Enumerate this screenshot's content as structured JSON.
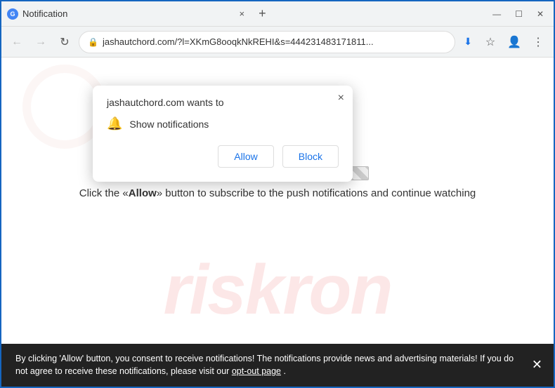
{
  "browser": {
    "title": "Notification",
    "favicon_label": "G",
    "url": "jashautchord.com/?l=XKmG8ooqkNkREHI&s=444231483171811...",
    "close_tab_label": "×",
    "new_tab_label": "+",
    "window_controls": {
      "minimize": "—",
      "maximize": "☐",
      "close": "✕"
    },
    "nav": {
      "back": "←",
      "forward": "→",
      "refresh": "↻"
    },
    "download_arrow": "⬇"
  },
  "notification_popup": {
    "close_label": "×",
    "title": "jashautchord.com wants to",
    "notification_label": "Show notifications",
    "allow_label": "Allow",
    "block_label": "Block"
  },
  "page": {
    "message_before": "Click the «",
    "message_keyword": "Allow",
    "message_after": "» button to subscribe to the push notifications and continue watching"
  },
  "consent_bar": {
    "text": "By clicking 'Allow' button, you consent to receive notifications! The notifications provide news and advertising materials! If you do not agree to receive these notifications, please visit our ",
    "link_text": "opt-out page",
    "text_end": ".",
    "close_label": "✕"
  },
  "watermark": {
    "text": "riskron"
  }
}
